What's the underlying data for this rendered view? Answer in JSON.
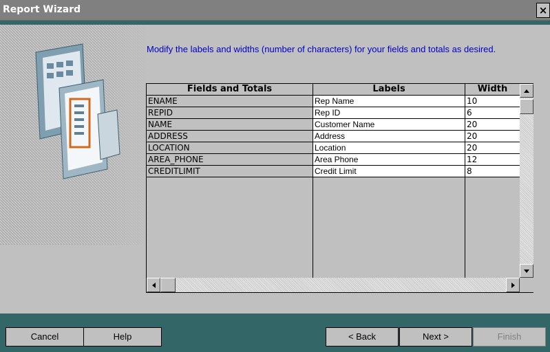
{
  "window": {
    "title": "Report Wizard",
    "close_label": "×"
  },
  "instruction": "Modify the labels and widths (number of characters) for your fields and totals as desired.",
  "grid": {
    "headers": [
      "Fields and Totals",
      "Labels",
      "Width"
    ],
    "rows": [
      {
        "field": "ENAME",
        "label": "Rep Name",
        "width": "10"
      },
      {
        "field": "REPID",
        "label": "Rep ID",
        "width": "6"
      },
      {
        "field": "NAME",
        "label": "Customer Name",
        "width": "20"
      },
      {
        "field": "ADDRESS",
        "label": "Address",
        "width": "20"
      },
      {
        "field": "LOCATION",
        "label": "Location",
        "width": "20"
      },
      {
        "field": "AREA_PHONE",
        "label": "Area Phone",
        "width": "12"
      },
      {
        "field": "CREDITLIMIT",
        "label": "Credit Limit",
        "width": "8"
      }
    ]
  },
  "buttons": {
    "cancel": "Cancel",
    "help": "Help",
    "back": "< Back",
    "next": "Next >",
    "finish": "Finish"
  },
  "colors": {
    "title_bar": "#808080",
    "accent_teal": "#336666",
    "instruction_text": "#0000c8"
  }
}
